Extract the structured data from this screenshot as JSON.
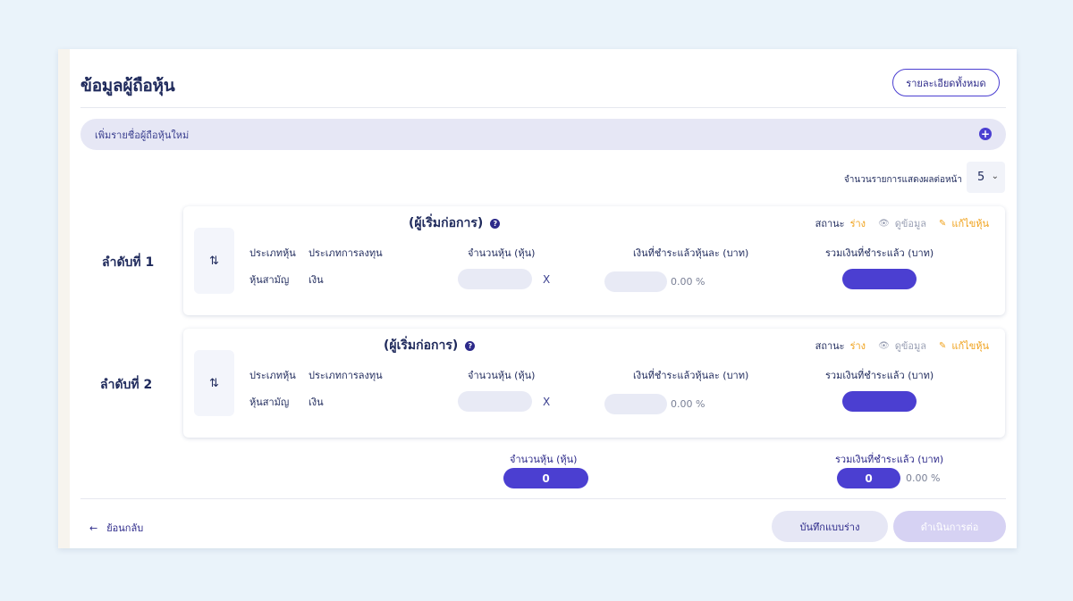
{
  "page": {
    "title": "ข้อมูลผู้ถือหุ้น",
    "details_button": "รายละเอียดทั้งหมด",
    "add_bar": "เพิ่มรายชื่อผู้ถือหุ้นใหม่",
    "add_icon": "plus-circle-icon"
  },
  "pagination": {
    "label": "จำนวนรายการแสดงผลต่อหน้า",
    "value": "5"
  },
  "headers": {
    "share_type": "ประเภทหุ้น",
    "invest_type": "ประเภทการลงทุน",
    "share_count": "จำนวนหุ้น (หุ้น)",
    "paid_per_share": "เงินที่ชำระแล้วหุ้นละ (บาท)",
    "total_paid": "รวมเงินที่ชำระแล้ว (บาท)"
  },
  "shareholders": [
    {
      "order": "ลำดับที่ 1",
      "title": "(ผู้เริ่มก่อการ)",
      "status_label": "สถานะ",
      "status_value": "ร่าง",
      "view_label": "ดูข้อมูล",
      "edit_label": "แก้ไขหุ้น",
      "share_type": "หุ้นสามัญ",
      "invest_type": "เงิน",
      "multiply": "X",
      "percent": "0.00 %"
    },
    {
      "order": "ลำดับที่ 2",
      "title": "(ผู้เริ่มก่อการ)",
      "status_label": "สถานะ",
      "status_value": "ร่าง",
      "view_label": "ดูข้อมูล",
      "edit_label": "แก้ไขหุ้น",
      "share_type": "หุ้นสามัญ",
      "invest_type": "เงิน",
      "multiply": "X",
      "percent": "0.00 %"
    }
  ],
  "summary": {
    "share_count_label": "จำนวนหุ้น (หุ้น)",
    "share_count_value": "0",
    "total_paid_label": "รวมเงินที่ชำระแล้ว (บาท)",
    "total_paid_value": "0",
    "total_percent": "0.00 %"
  },
  "footer": {
    "back": "ย้อนกลับ",
    "save_draft": "บันทึกแบบร่าง",
    "next": "ดำเนินการต่อ"
  },
  "colors": {
    "accent": "#4b3fd1",
    "status": "#f0a21c",
    "text": "#1f2a5c"
  }
}
